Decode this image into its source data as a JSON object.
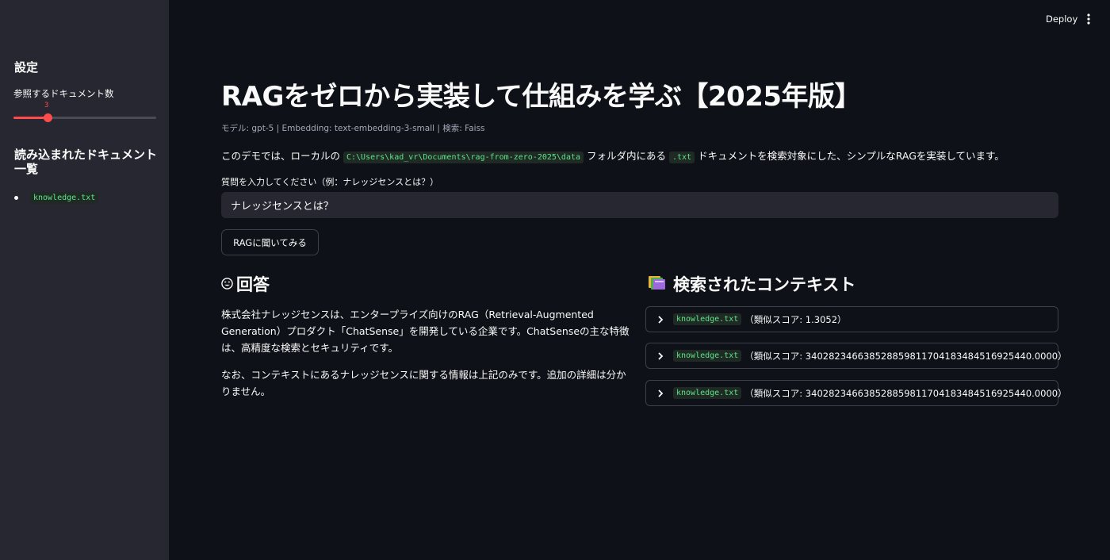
{
  "topbar": {
    "deploy_label": "Deploy"
  },
  "sidebar": {
    "settings_title": "設定",
    "slider": {
      "label": "参照するドキュメント数",
      "value": "3",
      "min": 1,
      "max": 10,
      "fill_fraction": 0.24
    },
    "docs_title": "読み込まれたドキュメント一覧",
    "docs": [
      "knowledge.txt"
    ]
  },
  "main": {
    "title": "RAGをゼロから実装して仕組みを学ぶ【2025年版】",
    "caption": "モデル: gpt-5 | Embedding: text-embedding-3-small | 検索: Faiss",
    "description": {
      "prefix": "このデモでは、ローカルの",
      "path": "C:\\Users\\kad_vr\\Documents\\rag-from-zero-2025\\data",
      "middle": "フォルダ内にある",
      "ext": ".txt",
      "suffix": "ドキュメントを検索対象にした、シンプルなRAGを実装しています。"
    },
    "input": {
      "label": "質問を入力してください（例：ナレッジセンスとは？）",
      "value": "ナレッジセンスとは？"
    },
    "ask_button": "RAGに聞いてみる"
  },
  "answer": {
    "icon": "😊",
    "title": "回答",
    "paragraphs": [
      "株式会社ナレッジセンスは、エンタープライズ向けのRAG（Retrieval-Augmented Generation）プロダクト「ChatSense」を開発している企業です。ChatSenseの主な特徴は、高精度な検索とセキュリティです。",
      "なお、コンテキストにあるナレッジセンスに関する情報は上記のみです。追加の詳細は分かりません。"
    ]
  },
  "context": {
    "icon": "books-icon",
    "title": "検索されたコンテキスト",
    "items": [
      {
        "doc": "knowledge.txt",
        "score": "（類似スコア: 1.3052）"
      },
      {
        "doc": "knowledge.txt",
        "score": "（類似スコア: 340282346638528859811704183484516925440.0000）"
      },
      {
        "doc": "knowledge.txt",
        "score": "（類似スコア: 340282346638528859811704183484516925440.0000）"
      }
    ]
  },
  "colors": {
    "background": "#0e1117",
    "sidebar": "#262730",
    "accent": "#ff4b4b",
    "code_text": "#5ce488"
  }
}
